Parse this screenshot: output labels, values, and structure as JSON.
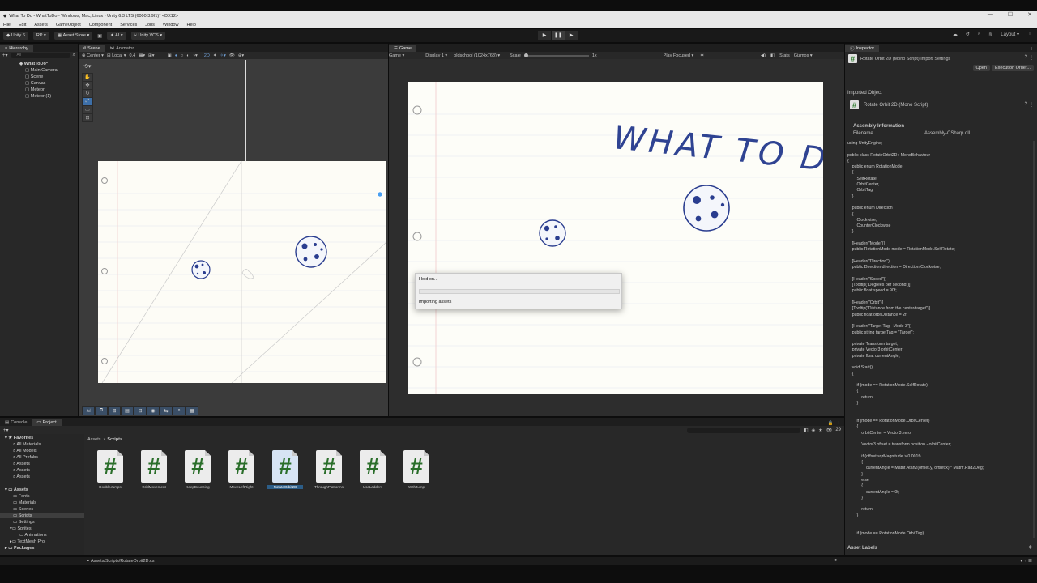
{
  "window": {
    "title": "What To Do - WhatToDo - Windows, Mac, Linux - Unity 6.3 LTS (6000.3.9f1)* <DX12>",
    "controls": [
      "—",
      "☐",
      "✕"
    ]
  },
  "menu": [
    "File",
    "Edit",
    "Assets",
    "GameObject",
    "Component",
    "Services",
    "Jobs",
    "Window",
    "Help"
  ],
  "toolbar": {
    "unity_label": "Unity 6",
    "account": "RP",
    "asset_store": "Asset Store",
    "ai": "AI",
    "vcs": "Unity VCS",
    "play": "▶",
    "pause": "❚❚",
    "step": "▶|",
    "layout": "Layout"
  },
  "hierarchy": {
    "tab": "Hierarchy",
    "search_placeholder": "All",
    "items": [
      "WhatToDo*",
      "Main Camera",
      "Scene",
      "Canvas",
      "Meteor",
      "Meteor (1)"
    ]
  },
  "scene": {
    "tabs": [
      "Scene",
      "Animator"
    ],
    "pivot": "Center",
    "space": "Local",
    "snap": "0.4",
    "mode_2d": "2D"
  },
  "game": {
    "tab": "Game",
    "mode": "Game",
    "display": "Display 1",
    "resolution": "oldschool (1024x768)",
    "scale_label": "Scale",
    "scale_value": "1x",
    "play_focused": "Play Focused",
    "stats": "Stats",
    "gizmos": "Gizmos",
    "heading": "WHAT TO DO"
  },
  "dialog": {
    "title": "Hold on...",
    "message": "Importing assets",
    "progress": 0
  },
  "inspector": {
    "tab": "Inspector",
    "title": "Rotate Orbit 2D (Mono Script) Import Settings",
    "open_button": "Open",
    "exec_order_button": "Execution Order...",
    "imported_object": "Imported Object",
    "object_name": "Rotate Orbit 2D (Mono Script)",
    "assembly_header": "Assembly Information",
    "filename_label": "Filename",
    "filename_value": "Assembly-CSharp.dll",
    "code": "using UnityEngine;\n\npublic class RotateOrbit2D : MonoBehaviour\n{\n    public enum RotationMode\n    {\n        SelfRotate,\n        OrbitCenter,\n        OrbitTag\n    }\n\n    public enum Direction\n    {\n        Clockwise,\n        CounterClockwise\n    }\n\n    [Header(\"Mode\")]\n    public RotationMode mode = RotationMode.SelfRotate;\n\n    [Header(\"Direction\")]\n    public Direction direction = Direction.Clockwise;\n\n    [Header(\"Speed\")]\n    [Tooltip(\"Degrees per second\")]\n    public float speed = 90f;\n\n    [Header(\"Orbit\")]\n    [Tooltip(\"Distance from the center/target\")]\n    public float orbitDistance = 2f;\n\n    [Header(\"Target Tag - Mode 3\")]\n    public string targetTag = \"Target\";\n\n    private Transform target;\n    private Vector3 orbitCenter;\n    private float currentAngle;\n\n    void Start()\n    {\n\n        if (mode == RotationMode.SelfRotate)\n        {\n            return;\n        }\n\n\n        if (mode == RotationMode.OrbitCenter)\n        {\n            orbitCenter = Vector3.zero;\n\n            Vector3 offset = transform.position - orbitCenter;\n\n            if (offset.sqrMagnitude > 0.001f)\n            {\n                currentAngle = Mathf.Atan2(offset.y, offset.x) * Mathf.Rad2Deg;\n            }\n            else\n            {\n                currentAngle = 0f;\n            }\n\n            return;\n        }\n\n\n        if (mode == RotationMode.OrbitTag)",
    "asset_labels": "Asset Labels"
  },
  "bottom": {
    "tabs": [
      "Console",
      "Project"
    ],
    "breadcrumb": [
      "Assets",
      "Scripts"
    ],
    "favorites_header": "Favorites",
    "favorites": [
      "All Materials",
      "All Models",
      "All Prefabs",
      "Assets",
      "Assets",
      "Assets"
    ],
    "assets_header": "Assets",
    "asset_folders": [
      "Fonts",
      "Materials",
      "Scenes",
      "Scripts",
      "Settings",
      "Sprites",
      "Animations",
      "TextMesh Pro"
    ],
    "packages_header": "Packages",
    "count": "29",
    "scripts": [
      "DoubleJumps",
      "GridMovement",
      "KeepBouncing",
      "MoveLeftRight",
      "RotateOrbit2D",
      "ThroughPlatforms",
      "UseLadders",
      "WithJump"
    ],
    "selected_script": "RotateOrbit2D"
  },
  "status": {
    "path": "Assets/Scripts/RotateOrbit2D.cs"
  },
  "colors": {
    "accent": "#3d6fa8",
    "selection": "#2c5d87",
    "paper": "#fdfcf6",
    "ink": "#2a3d8f"
  }
}
